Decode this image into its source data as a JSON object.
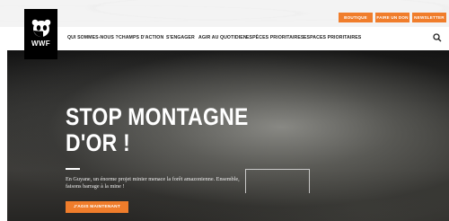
{
  "utility_buttons": [
    {
      "label": "BOUTIQUE"
    },
    {
      "label": "FAIRE UN DON"
    },
    {
      "label": "NEWSLETTER"
    }
  ],
  "logo": {
    "text": "WWF"
  },
  "nav": {
    "items": [
      {
        "label": "QUI SOMMES-NOUS ?"
      },
      {
        "label": "CHAMPS D'ACTION"
      },
      {
        "label": "S'ENGAGER"
      },
      {
        "label": "AGIR AU QUOTIDIEN"
      },
      {
        "label": "ESPÈCES PRIORITAIRES"
      },
      {
        "label": "ESPACES PRIORITAIRES"
      }
    ]
  },
  "hero": {
    "title_line1": "STOP MONTAGNE",
    "title_line2": "D'OR !",
    "description": "En Guyane, un énorme projet minier menace la forêt amazonienne. Ensemble, faisons barrage à la mine !",
    "cta_label": "J'AGIS MAINTENANT"
  },
  "colors": {
    "accent": "#f07d2b",
    "logo_bg": "#000000"
  }
}
